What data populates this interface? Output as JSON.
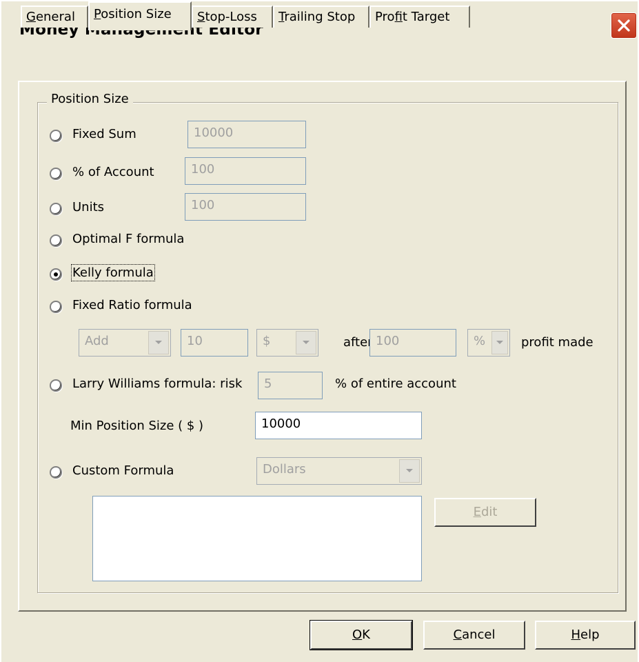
{
  "window": {
    "title": "Money Management Editor"
  },
  "tabs": [
    {
      "label_first": "G",
      "label_rest": "eneral",
      "active": false
    },
    {
      "label_first": "P",
      "label_rest": "osition Size",
      "active": true
    },
    {
      "label_first": "S",
      "label_rest": "top-Loss",
      "active": false
    },
    {
      "label_first": "T",
      "label_rest": "railing Stop",
      "active": false
    },
    {
      "label_pre": "Pro",
      "label_first": "f",
      "label_rest": "it Target",
      "active": false
    }
  ],
  "group": {
    "label": "Position Size"
  },
  "options": {
    "fixed_sum": {
      "label": "Fixed Sum",
      "value": "10000",
      "checked": false
    },
    "pct_account": {
      "label": "% of Account",
      "value": "100",
      "checked": false
    },
    "units": {
      "label": "Units",
      "value": "100",
      "checked": false
    },
    "optimal_f": {
      "label": "Optimal F formula",
      "checked": false
    },
    "kelly": {
      "label": "Kelly formula",
      "checked": true
    },
    "fixed_ratio": {
      "label": "Fixed Ratio formula",
      "checked": false,
      "action": "Add",
      "amount": "10",
      "unit": "$",
      "after_label": "after",
      "after_value": "100",
      "after_unit": "%",
      "profit_label": "profit made"
    },
    "larry_williams": {
      "label": "Larry Williams formula: risk",
      "value": "5",
      "suffix": "% of entire account",
      "checked": false
    },
    "min_position": {
      "label": "Min Position Size ( $ )",
      "value": "10000"
    },
    "custom": {
      "label": "Custom Formula",
      "unit": "Dollars",
      "checked": false,
      "formula": ""
    }
  },
  "buttons": {
    "edit_first": "E",
    "edit_rest": "dit",
    "ok_first": "O",
    "ok_rest": "K",
    "cancel_first": "C",
    "cancel_rest": "ancel",
    "help_first": "H",
    "help_rest": "elp"
  },
  "icons": {
    "close": "close-icon",
    "dropdown": "chevron-down-icon"
  }
}
